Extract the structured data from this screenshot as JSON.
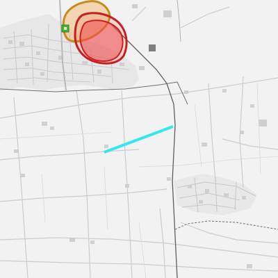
{
  "map": {
    "basemap_style": "light-gray",
    "background_color": "#f2f2f2",
    "road_color": "#c4c4c4",
    "minor_road_color": "#d4d4d4",
    "building_color": "#cdcdcd",
    "rail_color": "#5c5c5c",
    "boundary_color": "#6e6e6e"
  },
  "overlays": [
    {
      "name": "orange-zone",
      "fill": "#f2a23a",
      "fill_opacity": 0.35,
      "stroke": "#c98a1d"
    },
    {
      "name": "red-zone-outer",
      "fill": "#e8342f",
      "fill_opacity": 0.15,
      "stroke": "#c51f1f"
    },
    {
      "name": "red-zone-inner",
      "fill": "#f05050",
      "fill_opacity": 0.55,
      "stroke": "#d01d1d"
    },
    {
      "name": "highlight-segment",
      "stroke": "#33e7ee"
    }
  ],
  "markers": [
    {
      "name": "green-square-marker",
      "fill": "#4caf36",
      "icon": "square-marker"
    }
  ]
}
